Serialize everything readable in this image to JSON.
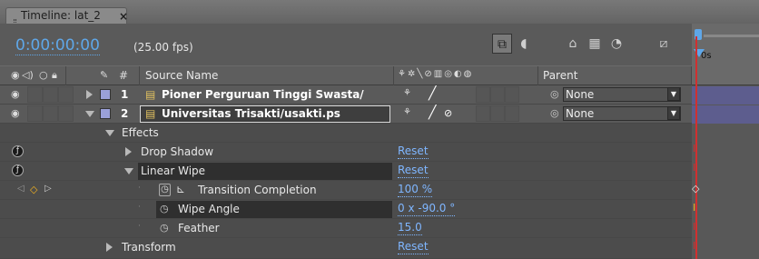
{
  "tab": {
    "title": "Timeline: lat_2",
    "close": "×"
  },
  "header": {
    "timecode": "0:00:00:00",
    "fps": "(25.00 fps)"
  },
  "columns": {
    "source_name": "Source Name",
    "hash": "#",
    "parent": "Parent"
  },
  "ruler": {
    "label": "0s"
  },
  "layers": [
    {
      "index": "1",
      "name": "Pioner Perguruan Tinggi Swasta/",
      "parent": "None",
      "color": "#9aa0d8"
    },
    {
      "index": "2",
      "name": "Universitas Trisakti/usakti.ps",
      "parent": "None",
      "color": "#9aa0d8"
    }
  ],
  "properties": {
    "effects": "Effects",
    "drop_shadow": {
      "label": "Drop Shadow",
      "value": "Reset"
    },
    "linear_wipe": {
      "label": "Linear Wipe",
      "value": "Reset"
    },
    "transition_completion": {
      "label": "Transition Completion",
      "value": "100 %"
    },
    "wipe_angle": {
      "label": "Wipe Angle",
      "value": "0 x -90.0 °"
    },
    "feather": {
      "label": "Feather",
      "value": "15.0"
    },
    "transform": {
      "label": "Transform",
      "value": "Reset"
    }
  },
  "colors": {
    "timecode": "#5fa7e8",
    "link": "#7fb6ff",
    "layer_bar": "#5d5d8e",
    "playhead": "#d03030",
    "keyframe": "#f0b020"
  }
}
